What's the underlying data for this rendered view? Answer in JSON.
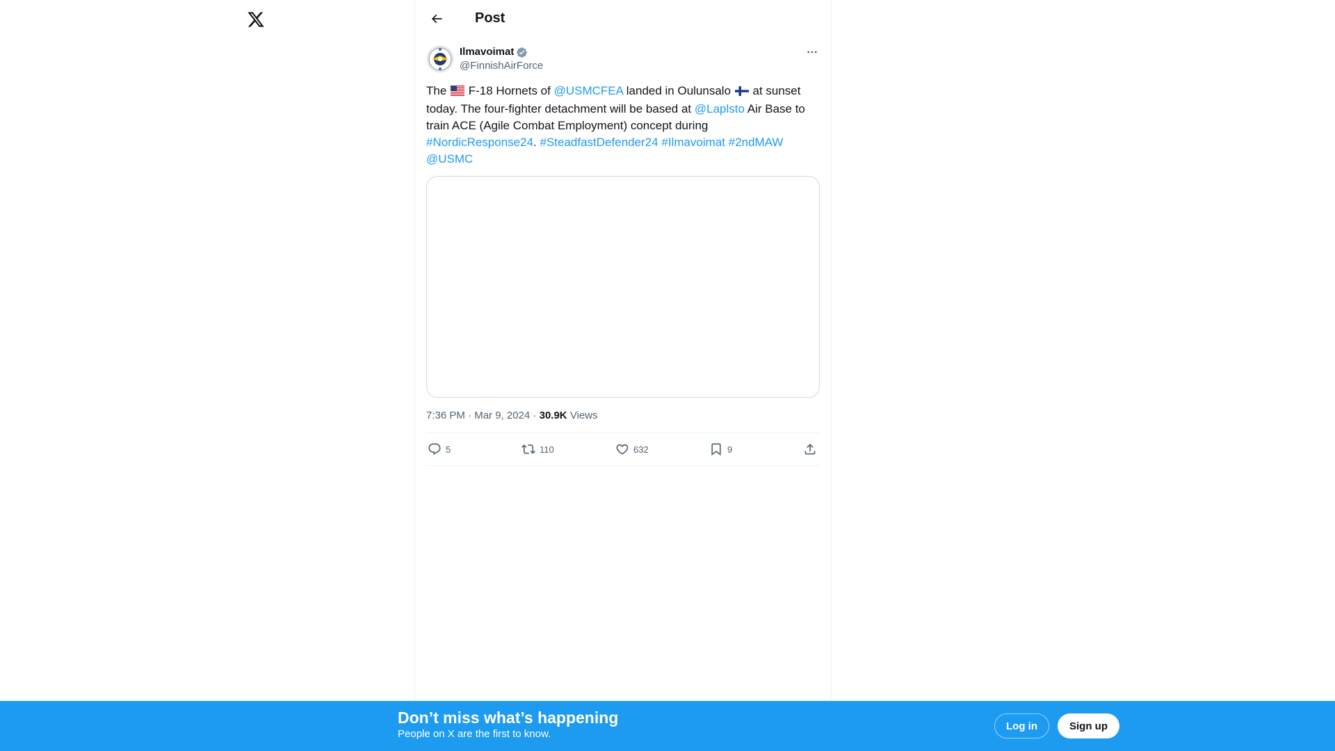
{
  "header": {
    "title": "Post"
  },
  "post": {
    "author": {
      "display_name": "Ilmavoimat",
      "handle": "@FinnishAirForce",
      "verified": true
    },
    "text": {
      "t1": "The ",
      "t2": " F-18 Hornets of ",
      "mention_usmcfea": "@USMCFEA",
      "t3": " landed in Oulunsalo ",
      "t4": " at sunset today. The four-fighter detachment will be based at ",
      "mention_laplsto": "@Laplsto",
      "t5": " Air Base to train ACE (Agile Combat Employment) concept during ",
      "hashtag_nordic": "#NordicResponse24",
      "t6": ". ",
      "hashtag_steadfast": "#SteadfastDefender24",
      "hashtag_ilmavoimat": "#Ilmavoimat",
      "hashtag_2ndmaw": "#2ndMAW",
      "mention_usmc": "@USMC"
    },
    "meta": {
      "time": "7:36 PM",
      "date": "Mar 9, 2024",
      "views_count": "30.9K",
      "views_label": "Views"
    },
    "actions": {
      "replies": "5",
      "reposts": "110",
      "likes": "632",
      "bookmarks": "9"
    }
  },
  "banner": {
    "title": "Don’t miss what’s happening",
    "subtitle": "People on X are the first to know.",
    "login_label": "Log in",
    "signup_label": "Sign up"
  },
  "colors": {
    "accent": "#1d9bf0",
    "text_primary": "#0f1419",
    "text_secondary": "#536471",
    "border": "#eff3f4"
  }
}
